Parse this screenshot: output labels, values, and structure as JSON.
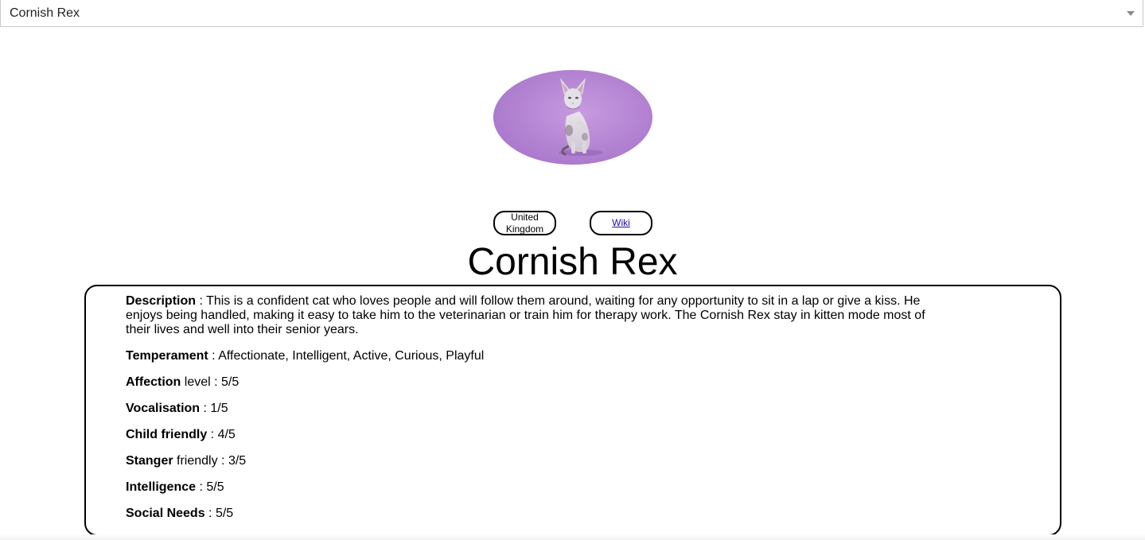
{
  "breed_select": {
    "selected": "Cornish Rex"
  },
  "photo": {
    "alt": "Cornish Rex",
    "background_color": "#b98fd8"
  },
  "origin_label": "United Kingdom",
  "wiki_link_label": "Wiki",
  "breed_name": "Cornish Rex",
  "details": {
    "description": {
      "label": "Description",
      "value": " : This is a confident cat who loves people and will follow them around, waiting for any opportunity to sit in a lap or give a kiss. He enjoys being handled, making it easy to take him to the veterinarian or train him for therapy work. The Cornish Rex stay in kitten mode most of their lives and well into their senior years."
    },
    "temperament": {
      "label": "Temperament",
      "value": " : Affectionate, Intelligent, Active, Curious, Playful"
    },
    "affection": {
      "label": "Affection",
      "value": " level : 5/5"
    },
    "vocalisation": {
      "label": "Vocalisation",
      "value": " : 1/5"
    },
    "child_friendly": {
      "label": "Child friendly",
      "value": " : 4/5"
    },
    "stranger_friendly": {
      "label": "Stanger",
      "value": " friendly : 3/5"
    },
    "intelligence": {
      "label": "Intelligence",
      "value": " : 5/5"
    },
    "social_needs": {
      "label": "Social Needs",
      "value": " : 5/5"
    }
  }
}
